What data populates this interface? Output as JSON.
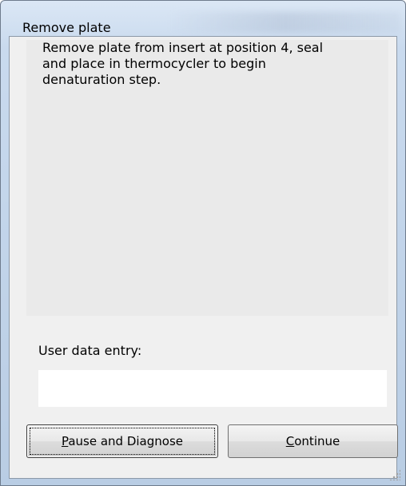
{
  "window": {
    "title": "Remove plate"
  },
  "message": {
    "text": "Remove plate from insert at position 4, seal\nand place in thermocycler to begin\ndenaturation step."
  },
  "entry": {
    "label": "User data entry:",
    "value": "",
    "placeholder": ""
  },
  "buttons": {
    "pause": {
      "mnemonic": "P",
      "rest": "ause and Diagnose"
    },
    "continue": {
      "mnemonic": "C",
      "rest": "ontinue"
    }
  },
  "icons": {
    "resize_grip": "size-grip-icon"
  }
}
